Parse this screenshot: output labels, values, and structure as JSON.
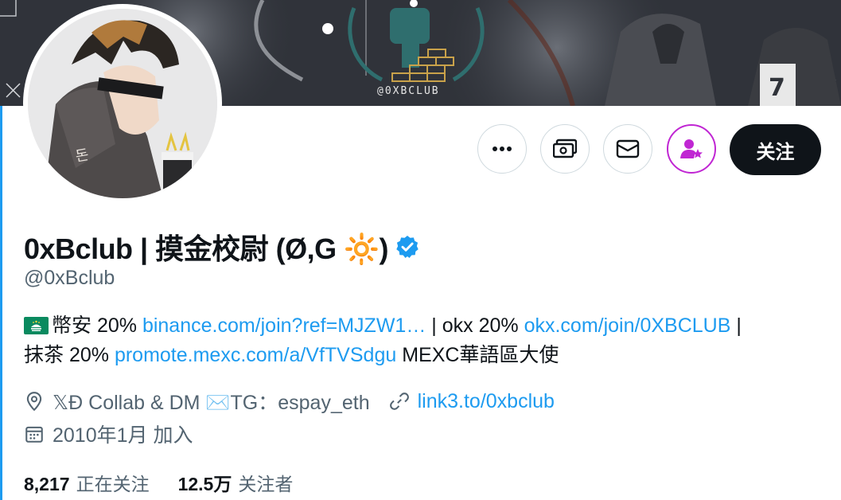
{
  "banner": {
    "handle_text": "@0XBCLUB"
  },
  "actions": {
    "more_icon": "more-icon",
    "subscribe_icon": "money-icon",
    "message_icon": "mail-icon",
    "notify_icon": "person-star-icon",
    "follow_label": "关注"
  },
  "profile": {
    "display_name": "0xBclub | 摸金校尉 (Ø,G 🔆)",
    "verified": true,
    "handle": "@0xBclub"
  },
  "bio": {
    "line1_prefix": "幣安 20%",
    "binance_link": "binance.com/join?ref=MJZW1…",
    "okx_text": "| okx 20%",
    "okx_link": "okx.com/join/0XBCLUB",
    "sep": "|",
    "line2_prefix": "抹茶 20%",
    "mexc_link": "promote.mexc.com/a/VfTVSdgu",
    "mexc_suffix": "MEXC華語區大使"
  },
  "meta": {
    "location": "𝕏Đ Collab & DM ✉️TG：espay_eth",
    "website": "link3.to/0xbclub",
    "joined": "2010年1月 加入"
  },
  "stats": {
    "following_count": "8,217",
    "following_label": "正在关注",
    "followers_count": "12.5万",
    "followers_label": "关注者"
  },
  "colors": {
    "accent": "#1d9bf0",
    "text": "#0f1419",
    "muted": "#536471",
    "notify_ring": "#c026d3",
    "follow_bg": "#0f1419"
  }
}
